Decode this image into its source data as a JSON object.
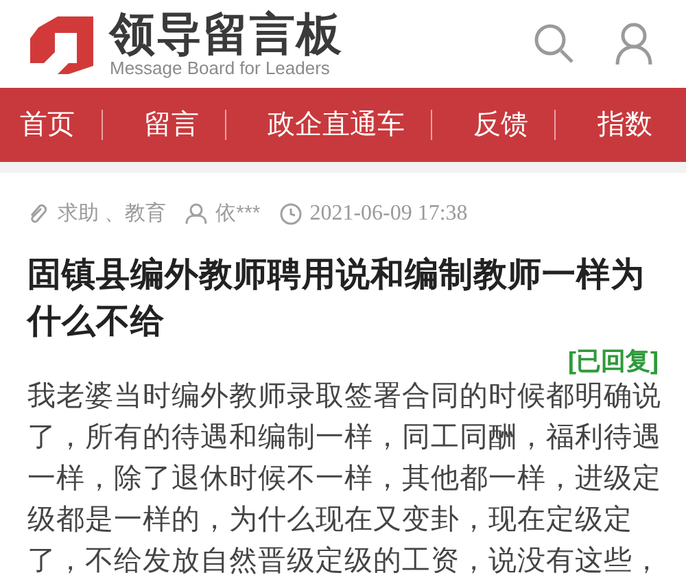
{
  "header": {
    "logo_title": "领导留言板",
    "logo_subtitle": "Message Board for Leaders"
  },
  "nav": [
    {
      "label": "首页"
    },
    {
      "label": "留言"
    },
    {
      "label": "政企直通车"
    },
    {
      "label": "反馈"
    },
    {
      "label": "指数"
    }
  ],
  "post": {
    "category": "求助 、教育",
    "author": "依***",
    "time": "2021-06-09 17:38",
    "title": "固镇县编外教师聘用说和编制教师一样为什么不给",
    "status": "[已回复]",
    "body": "我老婆当时编外教师录取签署合同的时候都明确说了，所有的待遇和编制一样，同工同酬，福利待遇一样，除了退休时候不一样，其他都一样，进级定级都是一样的，为什么现在又变卦，现在定级定了，不给发放自然晋级定级的工资，说没有这些，"
  }
}
